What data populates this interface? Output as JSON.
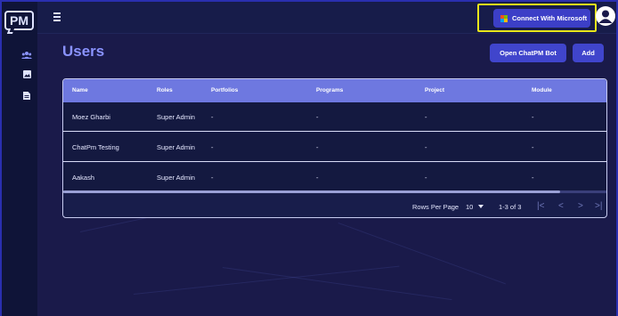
{
  "app": {
    "logo_text": "PM"
  },
  "sidebar": {
    "items": [
      {
        "icon": "users-icon"
      },
      {
        "icon": "image-icon"
      },
      {
        "icon": "document-icon"
      }
    ]
  },
  "header": {
    "menu_icon": "hamburger-icon",
    "connect_label": "Connect With Microsoft",
    "avatar_icon": "user-avatar-icon"
  },
  "main": {
    "title": "Users",
    "open_bot_label": "Open ChatPM Bot",
    "add_label": "Add"
  },
  "table": {
    "columns": [
      "Name",
      "Roles",
      "Portfolios",
      "Programs",
      "Project",
      "Module"
    ],
    "rows": [
      [
        "Moez Gharbi",
        "Super Admin",
        "-",
        "-",
        "-",
        "-"
      ],
      [
        "ChatPm Testing",
        "Super Admin",
        "-",
        "-",
        "-",
        "-"
      ],
      [
        "Aakash",
        "Super Admin",
        "-",
        "-",
        "-",
        "-"
      ]
    ],
    "pagination": {
      "rows_per_page_label": "Rows Per Page",
      "rows_per_page_value": "10",
      "range": "1-3 of 3",
      "first": "|<",
      "prev": "<",
      "next": ">",
      "last": ">|"
    }
  },
  "colors": {
    "background": "#1a1a4a",
    "accent": "#4045cc",
    "header_row": "#6e78e0",
    "highlight": "#e8e61a"
  }
}
